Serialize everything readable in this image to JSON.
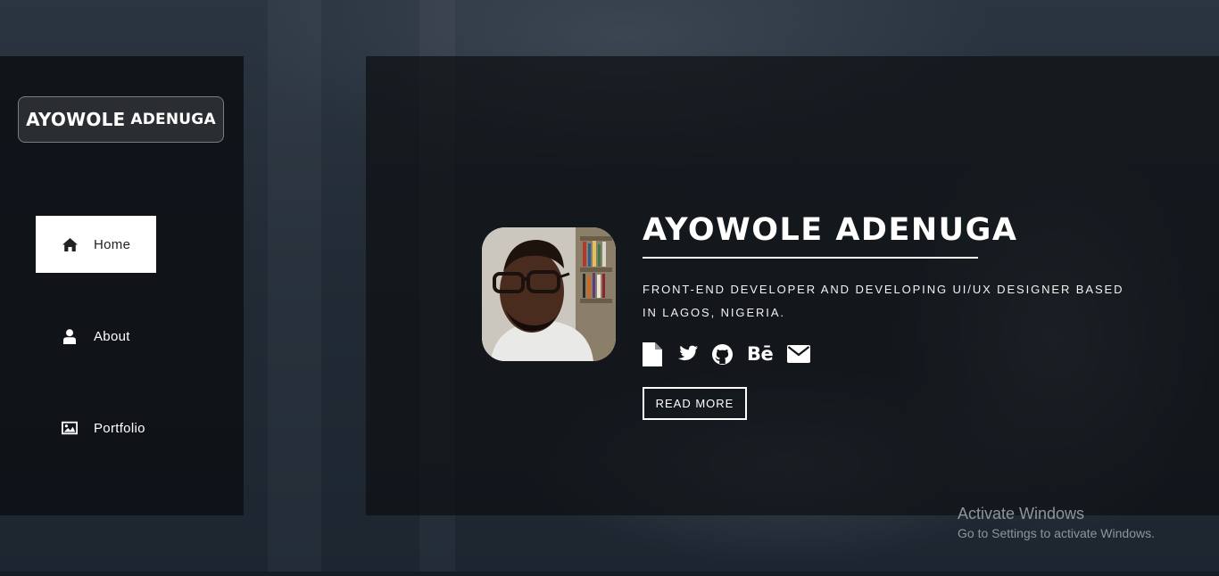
{
  "sidebar": {
    "logo": {
      "first": "AYOWOLE",
      "last": "ADENUGA"
    },
    "items": [
      {
        "label": "Home",
        "icon": "home-icon",
        "active": true
      },
      {
        "label": "About",
        "icon": "user-icon",
        "active": false
      },
      {
        "label": "Portfolio",
        "icon": "image-icon",
        "active": false
      }
    ]
  },
  "hero": {
    "name": "AYOWOLE ADENUGA",
    "tagline": "FRONT-END DEVELOPER AND DEVELOPING UI/UX DESIGNER BASED IN LAGOS, NIGERIA.",
    "socials": [
      {
        "icon": "document-icon"
      },
      {
        "icon": "twitter-icon"
      },
      {
        "icon": "github-icon"
      },
      {
        "icon": "behance-icon",
        "text": "Bē"
      },
      {
        "icon": "envelope-icon"
      }
    ],
    "read_more_label": "READ MORE",
    "photo_icon": "profile-photo"
  },
  "os_watermark": {
    "title": "Activate Windows",
    "subtitle": "Go to Settings to activate Windows."
  },
  "colors": {
    "panel": "#0e1014",
    "accent": "#ffffff",
    "background": "#1f2933",
    "watermark": "#8d949c"
  }
}
